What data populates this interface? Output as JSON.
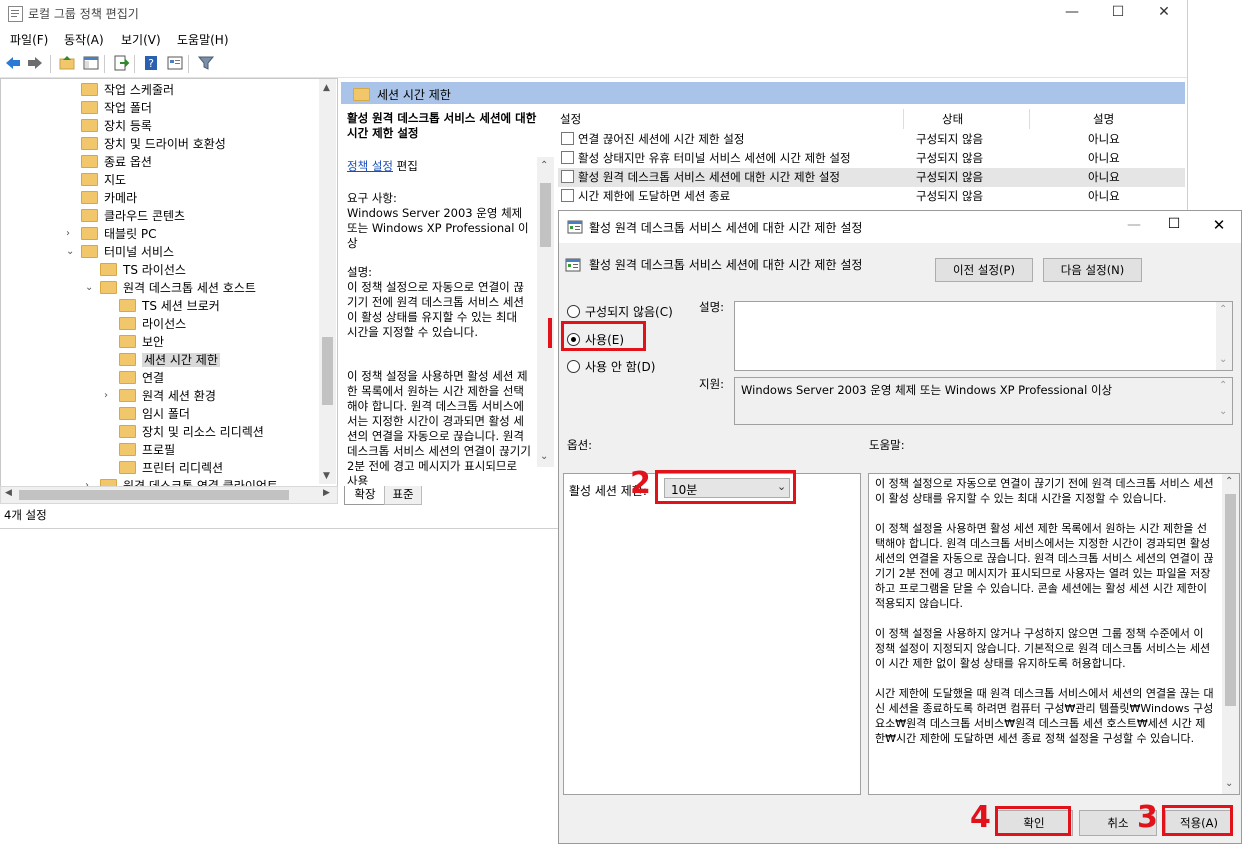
{
  "window": {
    "title": "로컬 그룹 정책 편집기",
    "controls": [
      "—",
      "☐",
      "✕"
    ]
  },
  "menu": [
    "파일(F)",
    "동작(A)",
    "보기(V)",
    "도움말(H)"
  ],
  "tree": {
    "items": [
      {
        "label": "작업 스케줄러",
        "depth": 4
      },
      {
        "label": "작업 폴더",
        "depth": 4
      },
      {
        "label": "장치 등록",
        "depth": 4
      },
      {
        "label": "장치 및 드라이버 호환성",
        "depth": 4
      },
      {
        "label": "종료 옵션",
        "depth": 4
      },
      {
        "label": "지도",
        "depth": 4
      },
      {
        "label": "카메라",
        "depth": 4
      },
      {
        "label": "클라우드 콘텐츠",
        "depth": 4
      },
      {
        "label": "태블릿 PC",
        "depth": 4,
        "expander": "›"
      },
      {
        "label": "터미널 서비스",
        "depth": 4,
        "expander": "⌄"
      },
      {
        "label": "TS 라이선스",
        "depth": 5
      },
      {
        "label": "원격 데스크톱 세션 호스트",
        "depth": 5,
        "expander": "⌄"
      },
      {
        "label": "TS 세션 브로커",
        "depth": 6
      },
      {
        "label": "라이선스",
        "depth": 6
      },
      {
        "label": "보안",
        "depth": 6
      },
      {
        "label": "세션 시간 제한",
        "depth": 6,
        "selected": true
      },
      {
        "label": "연결",
        "depth": 6
      },
      {
        "label": "원격 세션 환경",
        "depth": 6,
        "expander": "›"
      },
      {
        "label": "임시 폴더",
        "depth": 6
      },
      {
        "label": "장치 및 리소스 리디렉션",
        "depth": 6
      },
      {
        "label": "프로필",
        "depth": 6
      },
      {
        "label": "프린터 리디렉션",
        "depth": 6
      },
      {
        "label": "원격 데스크톱 연결 클라이언트",
        "depth": 5,
        "expander": "›"
      }
    ]
  },
  "status_bar": "4개 설정",
  "middle": {
    "header": "세션 시간 제한",
    "policy_title": "활성 원격 데스크톱 서비스 세션에 대한 시간 제한 설정",
    "edit_link": "정책 설정",
    "edit_suffix": " 편집",
    "req_label": "요구 사항:",
    "req_text": "Windows Server 2003 운영 체제 또는 Windows XP Professional 이상",
    "desc_label": "설명:",
    "desc_p1": "이 정책 설정으로 자동으로 연결이 끊기기 전에 원격 데스크톱 서비스 세션이 활성 상태를 유지할 수 있는 최대 시간을 지정할 수 있습니다.",
    "desc_p2": "이 정책 설정을 사용하면 활성 세션 제한 목록에서 원하는 시간 제한을 선택해야 합니다. 원격 데스크톱 서비스에서는 지정한 시간이 경과되면 활성 세션의 연결을 자동으로 끊습니다. 원격 데스크톱 서비스 세션의 연결이 끊기기 2분 전에 경고 메시지가 표시되므로 사용",
    "tab_extended": "확장",
    "tab_standard": "표준"
  },
  "list": {
    "headers": [
      "설정",
      "상태",
      "설명"
    ],
    "rows": [
      {
        "name": "연결 끊어진 세션에 시간 제한 설정",
        "state": "구성되지 않음",
        "comment": "아니요"
      },
      {
        "name": "활성 상태지만 유휴 터미널 서비스 세션에 시간 제한 설정",
        "state": "구성되지 않음",
        "comment": "아니요"
      },
      {
        "name": "활성 원격 데스크톱 서비스 세션에 대한 시간 제한 설정",
        "state": "구성되지 않음",
        "comment": "아니요",
        "selected": true
      },
      {
        "name": "시간 제한에 도달하면 세션 종료",
        "state": "구성되지 않음",
        "comment": "아니요"
      }
    ]
  },
  "dialog": {
    "title": "활성 원격 데스크톱 서비스 세션에 대한 시간 제한 설정",
    "subtitle": "활성 원격 데스크톱 서비스 세션에 대한 시간 제한 설정",
    "prev_button": "이전 설정(P)",
    "next_button": "다음 설정(N)",
    "radio_not_configured": "구성되지 않음(C)",
    "radio_enabled": "사용(E)",
    "radio_disabled": "사용 안 함(D)",
    "comment_label": "설명:",
    "supported_label": "지원:",
    "supported_text": "Windows Server 2003 운영 체제 또는 Windows XP Professional 이상",
    "options_label": "옵션:",
    "help_label": "도움말:",
    "option_field_label": "활성 세션 제한:",
    "option_value": "10분",
    "help_p1": "이 정책 설정으로 자동으로 연결이 끊기기 전에 원격 데스크톱 서비스 세션이 활성 상태를 유지할 수 있는 최대 시간을 지정할 수 있습니다.",
    "help_p2": "이 정책 설정을 사용하면 활성 세션 제한 목록에서 원하는 시간 제한을 선택해야 합니다. 원격 데스크톱 서비스에서는 지정한 시간이 경과되면 활성 세션의 연결을 자동으로 끊습니다. 원격 데스크톱 서비스 세션의 연결이 끊기기 2분 전에 경고 메시지가 표시되므로 사용자는 열려 있는 파일을 저장하고 프로그램을 닫을 수 있습니다. 콘솔 세션에는 활성 세션 시간 제한이 적용되지 않습니다.",
    "help_p3": "이 정책 설정을 사용하지 않거나 구성하지 않으면 그룹 정책 수준에서 이 정책 설정이 지정되지 않습니다. 기본적으로 원격 데스크톱 서비스는 세션이 시간 제한 없이 활성 상태를 유지하도록 허용합니다.",
    "help_p4": "시간 제한에 도달했을 때 원격 데스크톱 서비스에서 세션의 연결을 끊는 대신 세션을 종료하도록 하려면 컴퓨터 구성₩관리 템플릿₩Windows 구성 요소₩원격 데스크톱 서비스₩원격 데스크톱 세션 호스트₩세션 시간 제한₩시간 제한에 도달하면 세션 종료 정책 설정을 구성할 수 있습니다.",
    "ok_button": "확인",
    "cancel_button": "취소",
    "apply_button": "적용(A)"
  },
  "annotations": {
    "step1": "I",
    "step2": "2",
    "step3": "3",
    "step4": "4",
    "color": "#e2121b"
  }
}
